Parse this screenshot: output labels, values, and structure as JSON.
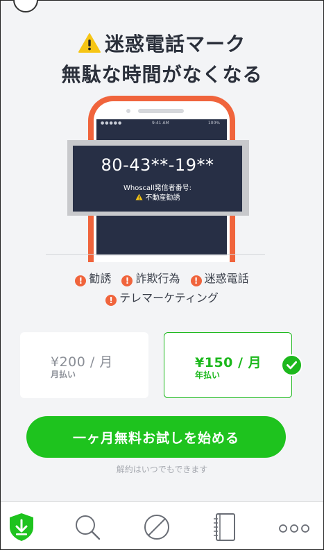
{
  "headline": {
    "line1": "迷惑電話マーク",
    "line2": "無駄な時間がなくなる"
  },
  "phone": {
    "status_time": "9:41 AM",
    "status_battery": "100%",
    "status_signal": "●●●●●"
  },
  "caller_card": {
    "number": "80-43**-19**",
    "label": "Whoscall発信者番号:",
    "tag": "不動産勧誘"
  },
  "categories": [
    {
      "label": "勧誘",
      "icon": "exclamation-icon"
    },
    {
      "label": "詐欺行為",
      "icon": "exclamation-icon"
    },
    {
      "label": "迷惑電話",
      "icon": "exclamation-icon"
    },
    {
      "label": "テレマーケティング",
      "icon": "exclamation-icon"
    }
  ],
  "plans": {
    "monthly": {
      "price": "¥200 / 月",
      "term": "月払い",
      "selected": false
    },
    "yearly": {
      "price": "¥150 / 月",
      "term": "年払い",
      "selected": true
    }
  },
  "cta": {
    "label": "一ヶ月無料お試しを始める"
  },
  "cancel_note": "解約はいつでもできます",
  "bottom_nav": [
    {
      "name": "download-shield",
      "icon": "shield-download-icon",
      "active": true
    },
    {
      "name": "search",
      "icon": "search-icon",
      "active": false
    },
    {
      "name": "block",
      "icon": "block-icon",
      "active": false
    },
    {
      "name": "contacts",
      "icon": "notebook-icon",
      "active": false
    },
    {
      "name": "more",
      "icon": "more-dots-icon",
      "active": false
    }
  ],
  "colors": {
    "accent_green": "#1ec31e",
    "warning_orange": "#f0643c",
    "dark_navy": "#272f45",
    "warn_yellow": "#f6c515"
  }
}
